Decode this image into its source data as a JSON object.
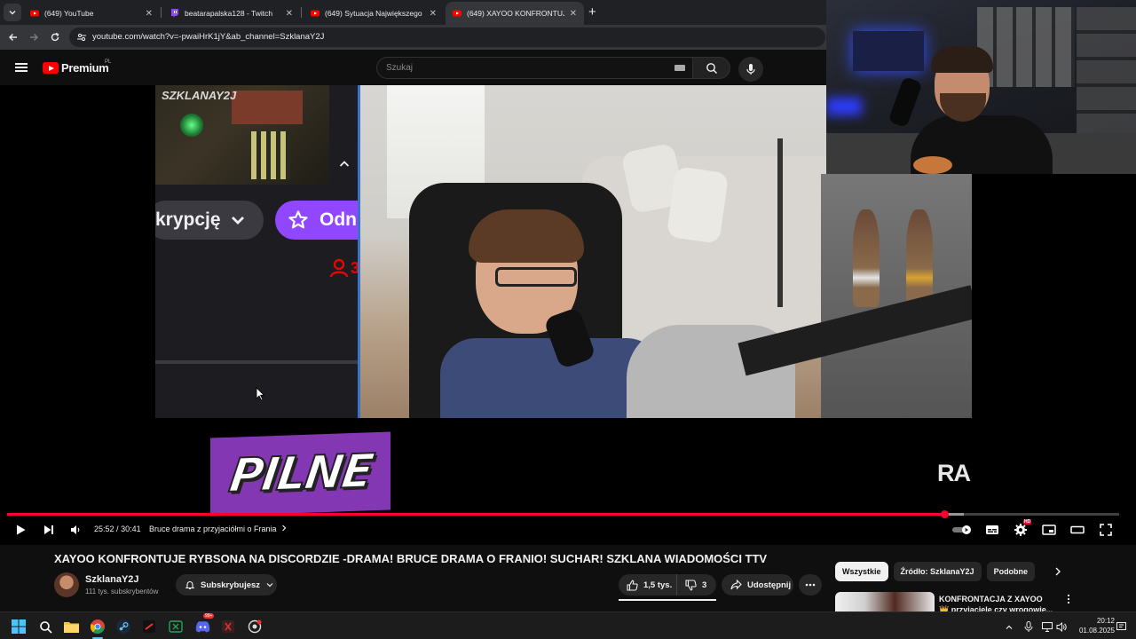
{
  "browser": {
    "tabs": [
      {
        "title": "(649) YouTube",
        "favicon": "youtube-icon",
        "active": false
      },
      {
        "title": "beatarapalska128 - Twitch",
        "favicon": "twitch-icon",
        "active": false
      },
      {
        "title": "(649) Sytuacja Największego O...",
        "favicon": "youtube-icon",
        "active": false
      },
      {
        "title": "(649) XAYOO KONFRONTUJE R...",
        "favicon": "youtube-icon",
        "active": true
      }
    ],
    "url": "youtube.com/watch?v=-pwaiHrK1jY&ab_channel=SzklanaY2J"
  },
  "yt_header": {
    "brand": "Premium",
    "country": "PL",
    "search_placeholder": "Szukaj"
  },
  "video_frame": {
    "stream_watermark": "SZKLANAY2J",
    "sub_button_text": "krypcję",
    "follow_button_text": "Odn",
    "viewer_count_fragment": "3",
    "breaking_banner": "PILNE",
    "ticker_text": "RA"
  },
  "player": {
    "current_time": "25:52",
    "duration": "30:41",
    "time_separator": "/",
    "chapter": "Bruce drama z przyjaciółmi o Frania",
    "played_fraction": 0.843,
    "buffered_fraction": 0.86,
    "quality_badge": "HD"
  },
  "video": {
    "title": "XAYOO KONFRONTUJE RYBSONA NA DISCORDZIE -DRAMA! BRUCE DRAMA O FRANIO! SUCHAR! SZKLANA WIADOMOŚCI TTV",
    "channel_name": "SzklanaY2J",
    "subscribers": "111 tys. subskrybentów",
    "subscribe_label": "Subskrybujesz",
    "likes": "1,5 tys.",
    "dislikes": "3",
    "share_label": "Udostępnij"
  },
  "sidebar": {
    "chips": [
      "Wszystkie",
      "Źródło: SzklanaY2J",
      "Podobne"
    ],
    "selected_chip": "Wszystkie",
    "recommendation_title": "KONFRONTACJA Z XAYOO 👑 przyjaciele czy wrogowie..."
  },
  "taskbar": {
    "time": "20:12",
    "date": "01.08.2025",
    "notification_badge": "99+"
  },
  "colors": {
    "youtube_red": "#ff0000",
    "progress_red": "#ff0033",
    "twitch_purple": "#9147ff",
    "banner_purple": "#8437b3",
    "background": "#0f0f0f"
  }
}
